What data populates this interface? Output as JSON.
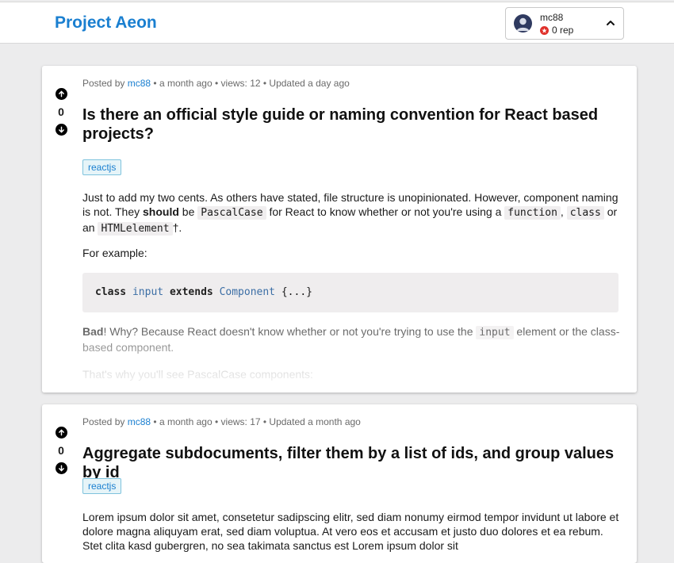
{
  "header": {
    "brand": "Project Aeon",
    "user": {
      "name": "mc88",
      "rep": "0 rep"
    }
  },
  "posts": [
    {
      "meta": {
        "prefix": "Posted by",
        "author": "mc88",
        "rest": "• a month ago • views: 12 • Updated a day ago"
      },
      "votes": "0",
      "title": "Is there an official style guide or naming convention for React based projects?",
      "tag": "reactjs",
      "p1": {
        "t1": "Just to add my two cents. As others have stated, file structure is unopinionated. However, component naming is not. They",
        "bold": "should",
        "t2": "be",
        "code1": "PascalCase",
        "t3": "for React to know whether or not you're using a",
        "code2": "function",
        "t4": ",",
        "code3": "class",
        "t5": "or an",
        "code4": "HTMLelement",
        "t6": "†."
      },
      "p2": "For example:",
      "code_block": {
        "kw1": "class",
        "ident": "input",
        "kw2": "extends",
        "cls": "Component",
        "rest": "{...}"
      },
      "p3": {
        "bold": "Bad",
        "t1": "! Why? Because React doesn't know whether or not you're trying to use the",
        "code": "input",
        "t2": "element or the class-based component."
      },
      "p4": "That's why you'll see PascalCase components:"
    },
    {
      "meta": {
        "prefix": "Posted by",
        "author": "mc88",
        "rest": "• a month ago • views: 17 • Updated a month ago"
      },
      "votes": "0",
      "title": "Aggregate subdocuments, filter them by a list of ids, and group values by id",
      "tag": "reactjs",
      "p1": "Lorem ipsum dolor sit amet, consetetur sadipscing elitr, sed diam nonumy eirmod tempor invidunt ut labore et dolore magna aliquyam erat, sed diam voluptua. At vero eos et accusam et justo duo dolores et ea rebum. Stet clita kasd gubergren, no sea takimata sanctus est Lorem ipsum dolor sit"
    }
  ]
}
